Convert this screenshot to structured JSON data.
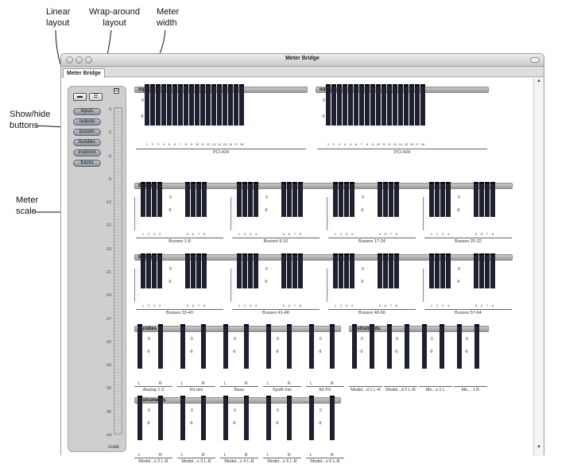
{
  "callouts": {
    "linear": "Linear\nlayout",
    "wrap": "Wrap-around\nlayout",
    "meter_width": "Meter\nwidth",
    "show_hide": "Show/hide\nbuttons",
    "meter_scale": "Meter\nscale"
  },
  "window": {
    "title": "Meter Bridge",
    "tab": "Meter Bridge"
  },
  "show_buttons": [
    "inputs",
    "outputs",
    "busses",
    "bundles",
    "instrmnt",
    "tracks"
  ],
  "scale": {
    "label": "scale",
    "ticks": [
      "0",
      "-3",
      "-6",
      "-9",
      "-12",
      "-15",
      "-18",
      "-21",
      "-24",
      "-27",
      "-30",
      "-33",
      "-36",
      "-45",
      "-inf"
    ]
  },
  "groups": {
    "inputs": {
      "title": "inputs",
      "caption": "PCI-424",
      "channels": [
        "1",
        "2",
        "3",
        "4",
        "5",
        "6",
        "7",
        "8",
        "9",
        "10",
        "11",
        "12",
        "13",
        "14",
        "15",
        "16",
        "17",
        "18"
      ]
    },
    "outputs": {
      "title": "outputs",
      "caption": "PCI-424",
      "channels": [
        "1",
        "2",
        "3",
        "4",
        "5",
        "6",
        "7",
        "8",
        "9",
        "10",
        "11",
        "12",
        "13",
        "14",
        "15",
        "16",
        "17",
        "18"
      ]
    },
    "busses1": {
      "title": "busses",
      "captions": [
        "Busses 1-8",
        "Busses 9-16",
        "Busses 17-24",
        "Busses 25-32"
      ]
    },
    "busses2": {
      "title": "busses",
      "captions": [
        "Busses 33-40",
        "Busses 41-48",
        "Busses 49-56",
        "Busses 57-64"
      ]
    },
    "bundles": {
      "title": "bundles",
      "captions": [
        "Analog 1-2",
        "Kit mix",
        "Bass",
        "Synth mix",
        "Kit FX"
      ]
    },
    "instruments1": {
      "title": "instruments",
      "captions": [
        "Model...d 1 L-R",
        "Model...d 2 L-R",
        "Mo...x 1 L",
        "Mo... 1 R"
      ]
    },
    "instruments2": {
      "title": "instruments",
      "captions": [
        "Model...x 2 L-R",
        "Model...x 3 L-R",
        "Model...x 4 L-R",
        "Model...x 5 L-R",
        "Model...x 6 L-R"
      ]
    }
  },
  "meter_scale_marks": {
    "zero": "0",
    "minus9": "-9"
  },
  "lr": {
    "l": "L",
    "r": "R"
  },
  "bus_channel_numbers": {
    "a": [
      "1",
      "2",
      "3",
      "4"
    ],
    "b": [
      "5",
      "6",
      "7",
      "8"
    ]
  }
}
